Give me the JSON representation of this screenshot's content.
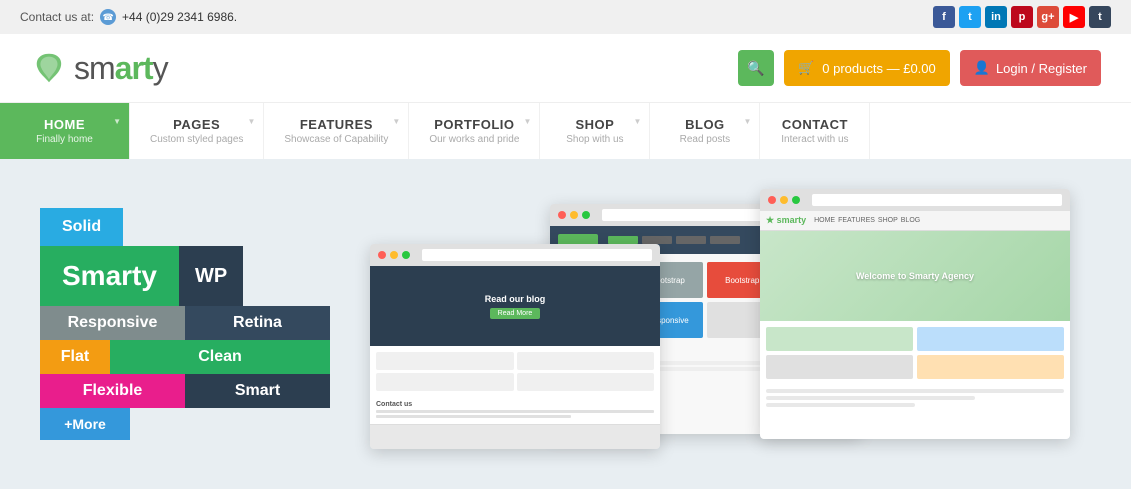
{
  "topbar": {
    "contact_label": "Contact us at:",
    "phone": "+44 (0)29 2341 6986.",
    "social": [
      "f",
      "t",
      "in",
      "p",
      "g+",
      "yt",
      "t"
    ]
  },
  "header": {
    "logo_text_sm": "sm",
    "logo_text_art": "art",
    "logo_text_y": "y",
    "search_label": "🔍",
    "cart_label": "0 products — £0.00",
    "login_label": "Login / Register"
  },
  "nav": {
    "items": [
      {
        "label": "HOME",
        "sub": "Finally home",
        "has_arrow": true
      },
      {
        "label": "PAGES",
        "sub": "Custom styled pages",
        "has_arrow": true
      },
      {
        "label": "FEATURES",
        "sub": "Showcase of Capability",
        "has_arrow": true
      },
      {
        "label": "PORTFOLIO",
        "sub": "Our works and pride",
        "has_arrow": true
      },
      {
        "label": "SHOP",
        "sub": "Shop with us",
        "has_arrow": true
      },
      {
        "label": "BLOG",
        "sub": "Read posts",
        "has_arrow": true
      },
      {
        "label": "CONTACT",
        "sub": "Interact with us",
        "has_arrow": false
      }
    ]
  },
  "hero": {
    "tags": [
      {
        "text": "Solid",
        "class": "tag-solid"
      },
      {
        "text": "Smarty",
        "class": "tag-smarty"
      },
      {
        "text": "WP",
        "class": "tag-wp"
      },
      {
        "text": "Responsive",
        "class": "tag-responsive"
      },
      {
        "text": "Retina",
        "class": "tag-retina"
      },
      {
        "text": "Flat",
        "class": "tag-flat"
      },
      {
        "text": "Clean",
        "class": "tag-clean"
      },
      {
        "text": "Flexible",
        "class": "tag-flexible"
      },
      {
        "text": "Smart",
        "class": "tag-smart"
      }
    ],
    "screen3_welcome": "Welcome to Smarty Agency",
    "screen4_blog": "Read our blog"
  }
}
